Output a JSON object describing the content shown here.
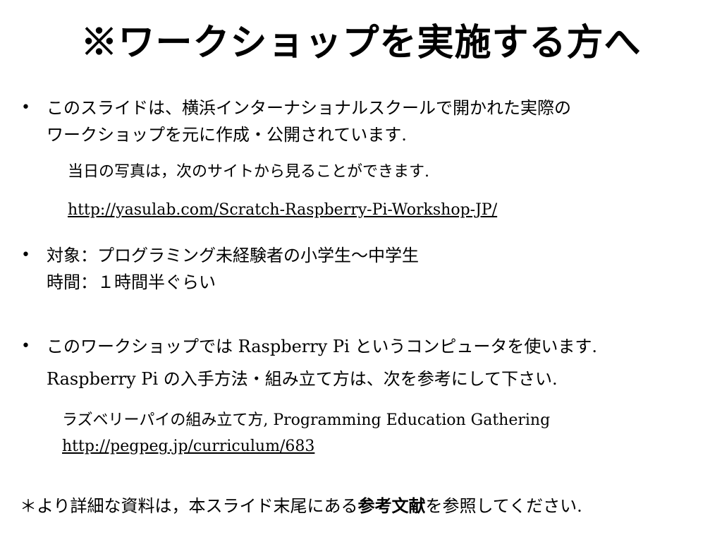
{
  "title": "※ワークショップを実施する方へ",
  "bullets": [
    {
      "dot": "•",
      "line1": "このスライドは、横浜インターナショナルスクールで開かれた実際の",
      "line2": "ワークショップを元に作成・公開されています."
    },
    {
      "dot": "•",
      "line1": "対象：プログラミング未経験者の小学生〜中学生",
      "line2": "時間：１時間半ぐらい"
    },
    {
      "dot": "•",
      "line1": "このワークショップでは Raspberry Pi というコンピュータを使います.",
      "line2": "Raspberry Pi の入手方法・組み立て方は、次を参考にして下さい."
    }
  ],
  "photos": {
    "text": "当日の写真は，次のサイトから見ることができます.",
    "url": "http://yasulab.com/Scratch-Raspberry-Pi-Workshop-JP/"
  },
  "reference": {
    "text": "ラズベリーパイの組み立て方, Programming Education Gathering",
    "url": "http://pegpeg.jp/curriculum/683"
  },
  "footer": {
    "prefix": "＊より詳細な資料は，本スライド末尾にある",
    "bold": "参考文献",
    "suffix": "を参照してください."
  }
}
